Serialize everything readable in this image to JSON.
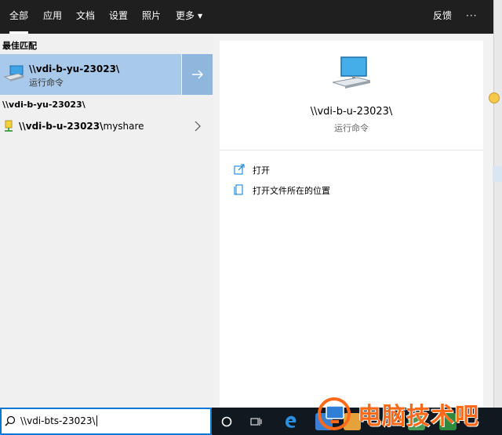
{
  "topbar": {
    "tabs": [
      {
        "label": "全部",
        "active": true
      },
      {
        "label": "应用"
      },
      {
        "label": "文档"
      },
      {
        "label": "设置"
      },
      {
        "label": "照片"
      },
      {
        "label": "更多"
      }
    ],
    "feedback_label": "反馈",
    "more_options_label": "···"
  },
  "results": {
    "best_match_header": "最佳匹配",
    "best_match": {
      "title": "\\\\vdi-b-yu-23023\\",
      "subtitle": "运行命令",
      "icon": "computer-icon"
    },
    "group_header": "\\\\vdi-b-yu-23023\\",
    "items": [
      {
        "prefix": "\\\\vdi-b-u-23023\\",
        "suffix": "myshare",
        "icon": "network-share-icon"
      }
    ]
  },
  "preview": {
    "title": "\\\\vdi-b-u-23023\\",
    "subtitle": "运行命令",
    "actions": [
      {
        "label": "打开",
        "icon": "open-icon"
      },
      {
        "label": "打开文件所在的位置",
        "icon": "open-file-location-icon"
      }
    ]
  },
  "search": {
    "value": "\\\\vdi-bts-23023\\",
    "icon": "search-icon"
  },
  "taskbar": {
    "apps": [
      "cortana-icon",
      "task-view-icon",
      "edge-icon",
      "app-icon",
      "app-icon",
      "app-icon",
      "app-icon"
    ]
  },
  "watermark": {
    "text": "电脑技术吧"
  },
  "colors": {
    "accent": "#0078d7",
    "selection": "#a9c9ea",
    "topbar": "#1f1f1f",
    "taskbar": "#101820",
    "watermark": "#ff6a1a"
  }
}
